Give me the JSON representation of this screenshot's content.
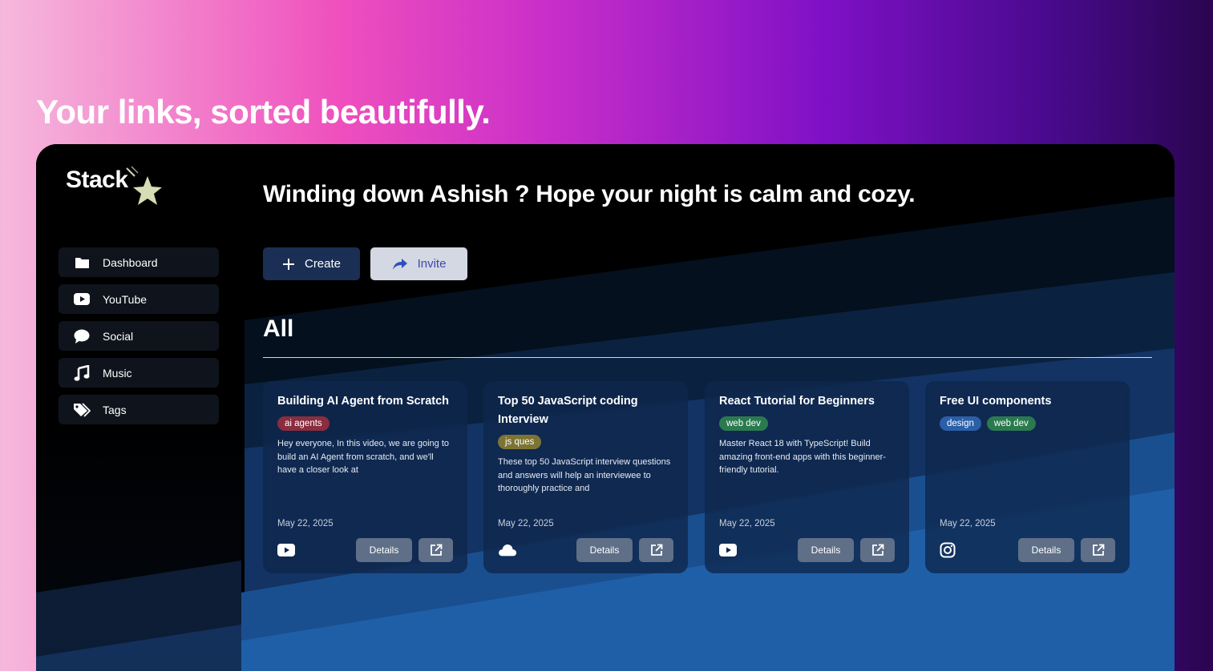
{
  "page": {
    "tagline": "Your links, sorted beautifully."
  },
  "app": {
    "logo_text": "Stack",
    "greeting": "Winding down Ashish ? Hope your night is calm and cozy.",
    "nav": [
      {
        "label": "Dashboard",
        "icon": "folder-icon"
      },
      {
        "label": "YouTube",
        "icon": "youtube-icon"
      },
      {
        "label": "Social",
        "icon": "chat-bubble-icon"
      },
      {
        "label": "Music",
        "icon": "music-note-icon"
      },
      {
        "label": "Tags",
        "icon": "tags-icon"
      }
    ],
    "actions": {
      "create_label": "Create",
      "invite_label": "Invite"
    },
    "section_title": "All",
    "cards": [
      {
        "title": "Building AI Agent from Scratch",
        "tags": [
          {
            "label": "ai agents",
            "color": "#8a2d3f"
          }
        ],
        "description": "Hey everyone, In this video, we are going to build an AI Agent from scratch, and we'll have a closer look at",
        "date": "May 22, 2025",
        "source_icon": "youtube-icon",
        "details_label": "Details"
      },
      {
        "title": "Top 50 JavaScript coding Interview",
        "tags": [
          {
            "label": "js ques",
            "color": "#7d7434"
          }
        ],
        "description": "These top 50 JavaScript interview questions and answers will help an interviewee to thoroughly practice and",
        "date": "May 22, 2025",
        "source_icon": "cloud-icon",
        "details_label": "Details"
      },
      {
        "title": "React Tutorial for Beginners",
        "tags": [
          {
            "label": "web dev",
            "color": "#2b7a4f"
          }
        ],
        "description": "Master React 18 with TypeScript! Build amazing front-end apps with this beginner-friendly tutorial.",
        "date": "May 22, 2025",
        "source_icon": "youtube-icon",
        "details_label": "Details"
      },
      {
        "title": "Free UI components",
        "tags": [
          {
            "label": "design",
            "color": "#2b5fa8"
          },
          {
            "label": "web dev",
            "color": "#2b7a4f"
          }
        ],
        "description": "",
        "date": "May 22, 2025",
        "source_icon": "instagram-icon",
        "details_label": "Details"
      }
    ]
  }
}
